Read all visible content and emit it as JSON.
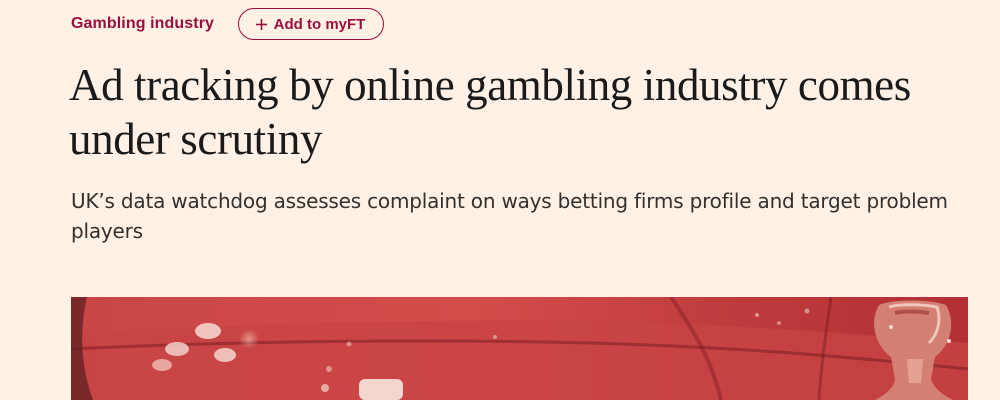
{
  "topic": {
    "label": "Gambling industry"
  },
  "myft_button": {
    "label": "Add to myFT",
    "icon": "plus-icon"
  },
  "article": {
    "headline": "Ad tracking by online gambling industry comes under scrutiny",
    "standfirst": "UK’s data watchdog assesses complaint on ways betting firms profile and target problem players"
  },
  "colors": {
    "background": "#fff1e5",
    "accent": "#990f3d",
    "headline": "#1a1a1a",
    "standfirst": "#33302e",
    "image_tint": "#c83a3c"
  }
}
